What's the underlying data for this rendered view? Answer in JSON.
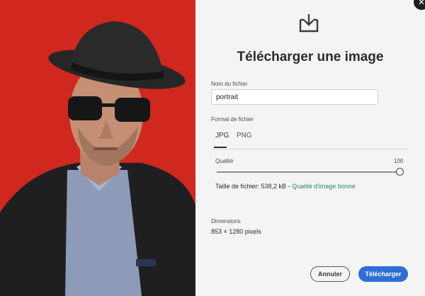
{
  "dialog": {
    "title": "Télécharger une image",
    "close_icon": "close-icon",
    "download_icon": "download-tray-icon"
  },
  "filename": {
    "label": "Nom du fichier",
    "value": "portrait"
  },
  "format": {
    "label": "Format de fichier",
    "tabs": [
      "JPG",
      "PNG"
    ],
    "selected": "JPG"
  },
  "quality": {
    "label": "Qualité",
    "max": "100",
    "value": 100
  },
  "file_size": {
    "text": "Taille de fichier: 538,2 kB - ",
    "rating": "Qualité d'image bonne"
  },
  "dimensions": {
    "label": "Dimensions",
    "value": "853 × 1280 pixels"
  },
  "buttons": {
    "cancel": "Annuler",
    "download": "Télécharger"
  },
  "colors": {
    "photo_background": "#d0281e",
    "primary_button": "#2e6fd6",
    "quality_good": "#2d8a5e"
  }
}
